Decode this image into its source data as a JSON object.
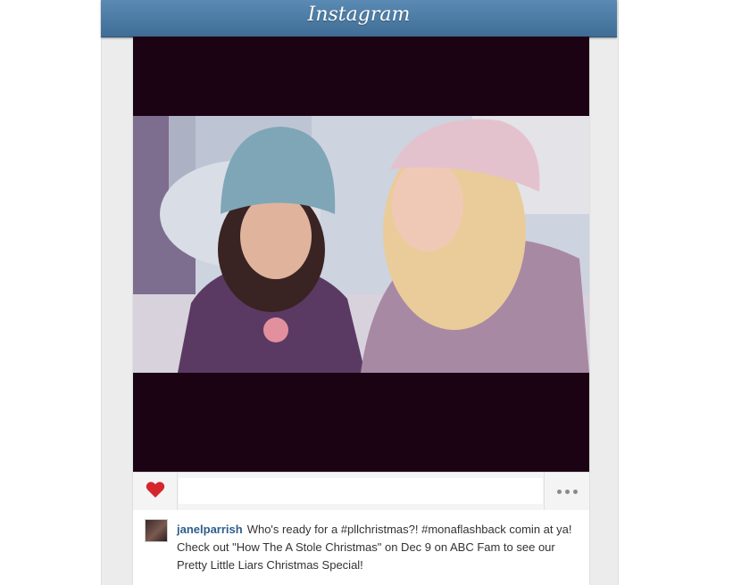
{
  "app": {
    "logo_text": "Instagram",
    "brand_color": "#3f6d96"
  },
  "post": {
    "username": "janelparrish",
    "caption": "Who's ready for a #pllchristmas?! #monaflashback comin at ya! Check out \"How The A Stole Christmas\" on Dec 9 on ABC Fam to see our Pretty Little Liars Christmas Special!",
    "like_icon": "heart-icon",
    "like_color": "#d5262e",
    "more_icon": "ellipsis-icon"
  }
}
